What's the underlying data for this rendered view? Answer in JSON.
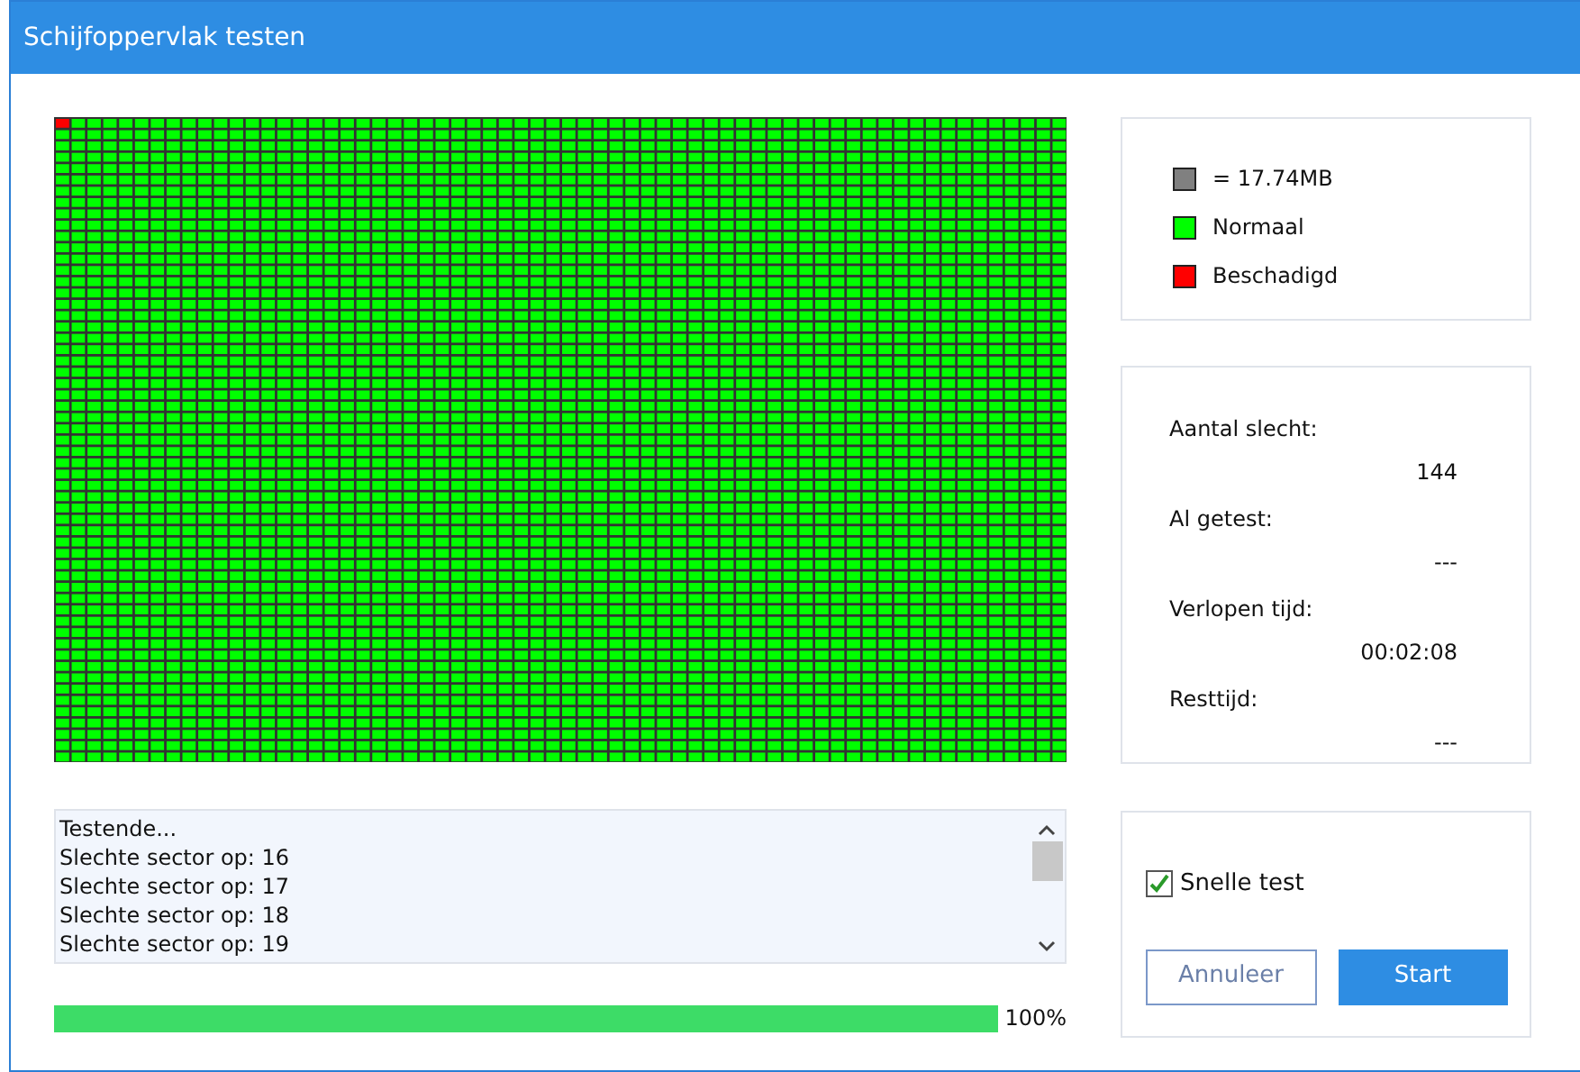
{
  "window": {
    "title": "Schijfoppervlak testen"
  },
  "legend": [
    {
      "label": "= 17.74MB",
      "color": "#808080"
    },
    {
      "label": "Normaal",
      "color": "#00ff00"
    },
    {
      "label": "Beschadigd",
      "color": "#ff0000"
    }
  ],
  "stats": [
    {
      "label": "Aantal slecht:",
      "value": "144"
    },
    {
      "label": "Al getest:",
      "value": "---"
    },
    {
      "label": "Verlopen tijd:",
      "value": "00:02:08"
    },
    {
      "label": "Resttijd:",
      "value": "---"
    }
  ],
  "log": [
    "Testende...",
    "Slechte sector op: 16",
    "Slechte sector op: 17",
    "Slechte sector op: 18",
    "Slechte sector op: 19"
  ],
  "progress": {
    "level": 1.0,
    "reading": "100%"
  },
  "quick_test": {
    "label": "Snelle test",
    "checked": true
  },
  "buttons": [
    {
      "label": "Annuleer",
      "kind": "secondary"
    },
    {
      "label": "Start",
      "kind": "primary"
    }
  ]
}
